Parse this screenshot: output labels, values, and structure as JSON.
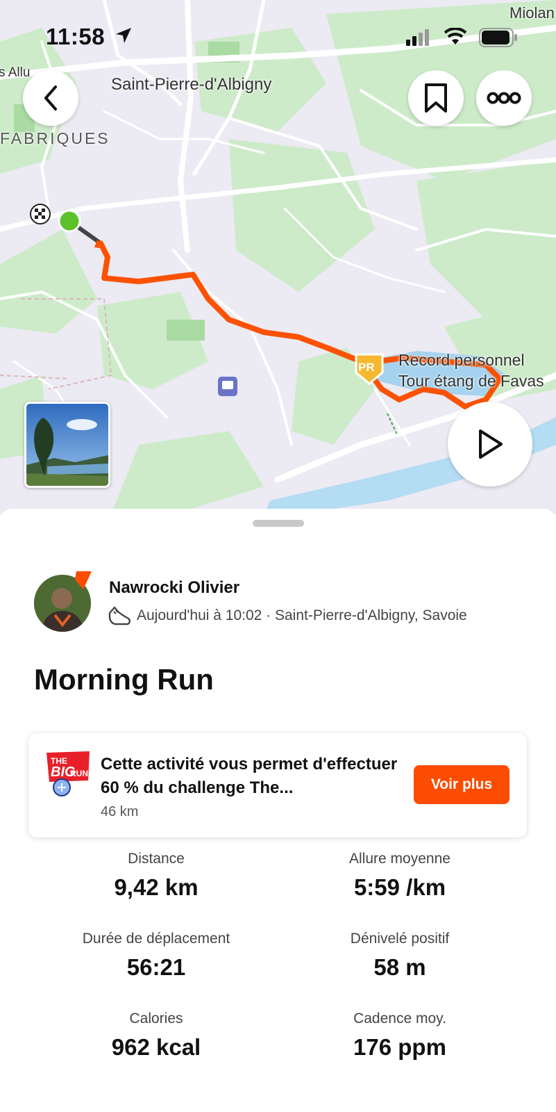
{
  "status_bar": {
    "time": "11:58"
  },
  "map": {
    "labels": {
      "town": "Saint-Pierre-d'Albigny",
      "fabriques": "FABRIQUES",
      "top_left": "s Allu",
      "top_right": "Miolan",
      "pr_line1": "Record personnel",
      "pr_line2": "Tour étang de Favas"
    },
    "pr_badge": "PR",
    "route_color": "#fc5200",
    "start_color": "#5cc12b"
  },
  "athlete": {
    "name": "Nawrocki Olivier",
    "meta": "Aujourd'hui à 10:02 · Saint-Pierre-d'Albigny, Savoie"
  },
  "activity": {
    "title": "Morning Run"
  },
  "challenge": {
    "text": "Cette activité vous permet d'effectuer 60 % du challenge The...",
    "sub": "46 km",
    "button": "Voir plus",
    "logo_text": "THE BIG RUN"
  },
  "stats": [
    {
      "label": "Distance",
      "value": "9,42 km"
    },
    {
      "label": "Allure moyenne",
      "value": "5:59 /km"
    },
    {
      "label": "Durée de déplacement",
      "value": "56:21"
    },
    {
      "label": "Dénivelé positif",
      "value": "58 m"
    },
    {
      "label": "Calories",
      "value": "962 kcal"
    },
    {
      "label": "Cadence moy.",
      "value": "176 ppm"
    }
  ],
  "colors": {
    "accent": "#fc4c02",
    "text": "#111111"
  }
}
